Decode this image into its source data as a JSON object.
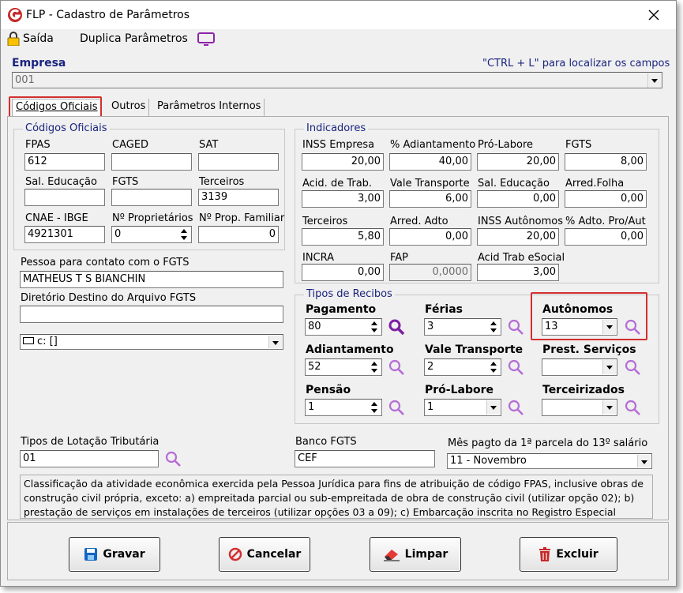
{
  "window": {
    "title": "FLP - Cadastro de Parâmetros"
  },
  "toolbar": {
    "exit_label": "Saída",
    "duplicate_label": "Duplica Parâmetros"
  },
  "empresa": {
    "label": "Empresa",
    "hint": "\"CTRL + L\" para localizar os campos",
    "value": "001"
  },
  "tabs": [
    {
      "label": "Códigos Oficiais"
    },
    {
      "label": "Outros"
    },
    {
      "label": "Parâmetros Internos"
    }
  ],
  "codigos": {
    "group_title": "Códigos Oficiais",
    "fpas_label": "FPAS",
    "fpas": "612",
    "caged_label": "CAGED",
    "caged": "",
    "sat_label": "SAT",
    "sat": "",
    "sal_educacao_label": "Sal. Educação",
    "sal_educacao": "",
    "fgts_label": "FGTS",
    "fgts": "",
    "terceiros_label": "Terceiros",
    "terceiros": "3139",
    "cnae_label": "CNAE - IBGE",
    "cnae": "4921301",
    "num_prop_label": "Nº Proprietários",
    "num_prop": "0",
    "num_prop_fam_label": "Nº Prop. Familiar",
    "num_prop_fam": "0"
  },
  "contato": {
    "label": "Pessoa para contato com o FGTS",
    "value": "MATHEUS T S BIANCHIN"
  },
  "diretorio": {
    "label": "Diretório Destino do Arquivo FGTS",
    "value": "",
    "drive": "c: []"
  },
  "indicadores": {
    "group_title": "Indicadores",
    "fields": [
      {
        "label": "INSS Empresa",
        "value": "20,00"
      },
      {
        "label": "% Adiantamento",
        "value": "40,00"
      },
      {
        "label": "Pró-Labore",
        "value": "20,00"
      },
      {
        "label": "FGTS",
        "value": "8,00"
      },
      {
        "label": "Acid. de Trab.",
        "value": "3,00"
      },
      {
        "label": "Vale Transporte",
        "value": "6,00"
      },
      {
        "label": "Sal. Educação",
        "value": "0,00"
      },
      {
        "label": "Arred.Folha",
        "value": "0,00"
      },
      {
        "label": "Terceiros",
        "value": "5,80"
      },
      {
        "label": "Arred. Adto",
        "value": "0,00"
      },
      {
        "label": "INSS Autônomos",
        "value": "20,00"
      },
      {
        "label": "% Adto. Pro/Aut",
        "value": "0,00"
      },
      {
        "label": "INCRA",
        "value": "0,00"
      },
      {
        "label": "FAP",
        "value": "0,0000"
      },
      {
        "label": "Acid Trab eSocial",
        "value": "3,00"
      }
    ]
  },
  "recibos": {
    "group_title": "Tipos de Recibos",
    "pagamento_label": "Pagamento",
    "pagamento": "80",
    "ferias_label": "Férias",
    "ferias": "3",
    "autonomos_label": "Autônomos",
    "autonomos": "13",
    "adiantamento_label": "Adiantamento",
    "adiantamento": "52",
    "vale_label": "Vale Transporte",
    "vale": "2",
    "prest_label": "Prest. Serviços",
    "prest": "",
    "pensao_label": "Pensão",
    "pensao": "1",
    "pro_labore_label": "Pró-Labore",
    "pro_labore": "1",
    "terceirizados_label": "Terceirizados",
    "terceirizados": ""
  },
  "lotacao": {
    "label": "Tipos de Lotação Tributária",
    "value": "01"
  },
  "banco": {
    "label": "Banco FGTS",
    "value": "CEF"
  },
  "mes": {
    "label": "Mês pagto da 1ª parcela do 13º salário",
    "value": "11 - Novembro"
  },
  "descricao": "Classificação da atividade econômica exercida pela Pessoa Jurídica para fins de atribuição de código FPAS, inclusive obras de construção civil própria, exceto: a) empreitada parcial ou sub-empreitada de obra de construção civil (utilizar opção 02); b) prestação de serviços em instalações de terceiros (utilizar opções 03 a 09); c) Embarcação inscrita no Registro Especial",
  "buttons": {
    "save": "Gravar",
    "cancel": "Cancelar",
    "clear": "Limpar",
    "delete": "Excluir"
  },
  "colors": {
    "accent": "#1a237e",
    "highlight": "#d32f2f",
    "search": "#a64ac9"
  }
}
